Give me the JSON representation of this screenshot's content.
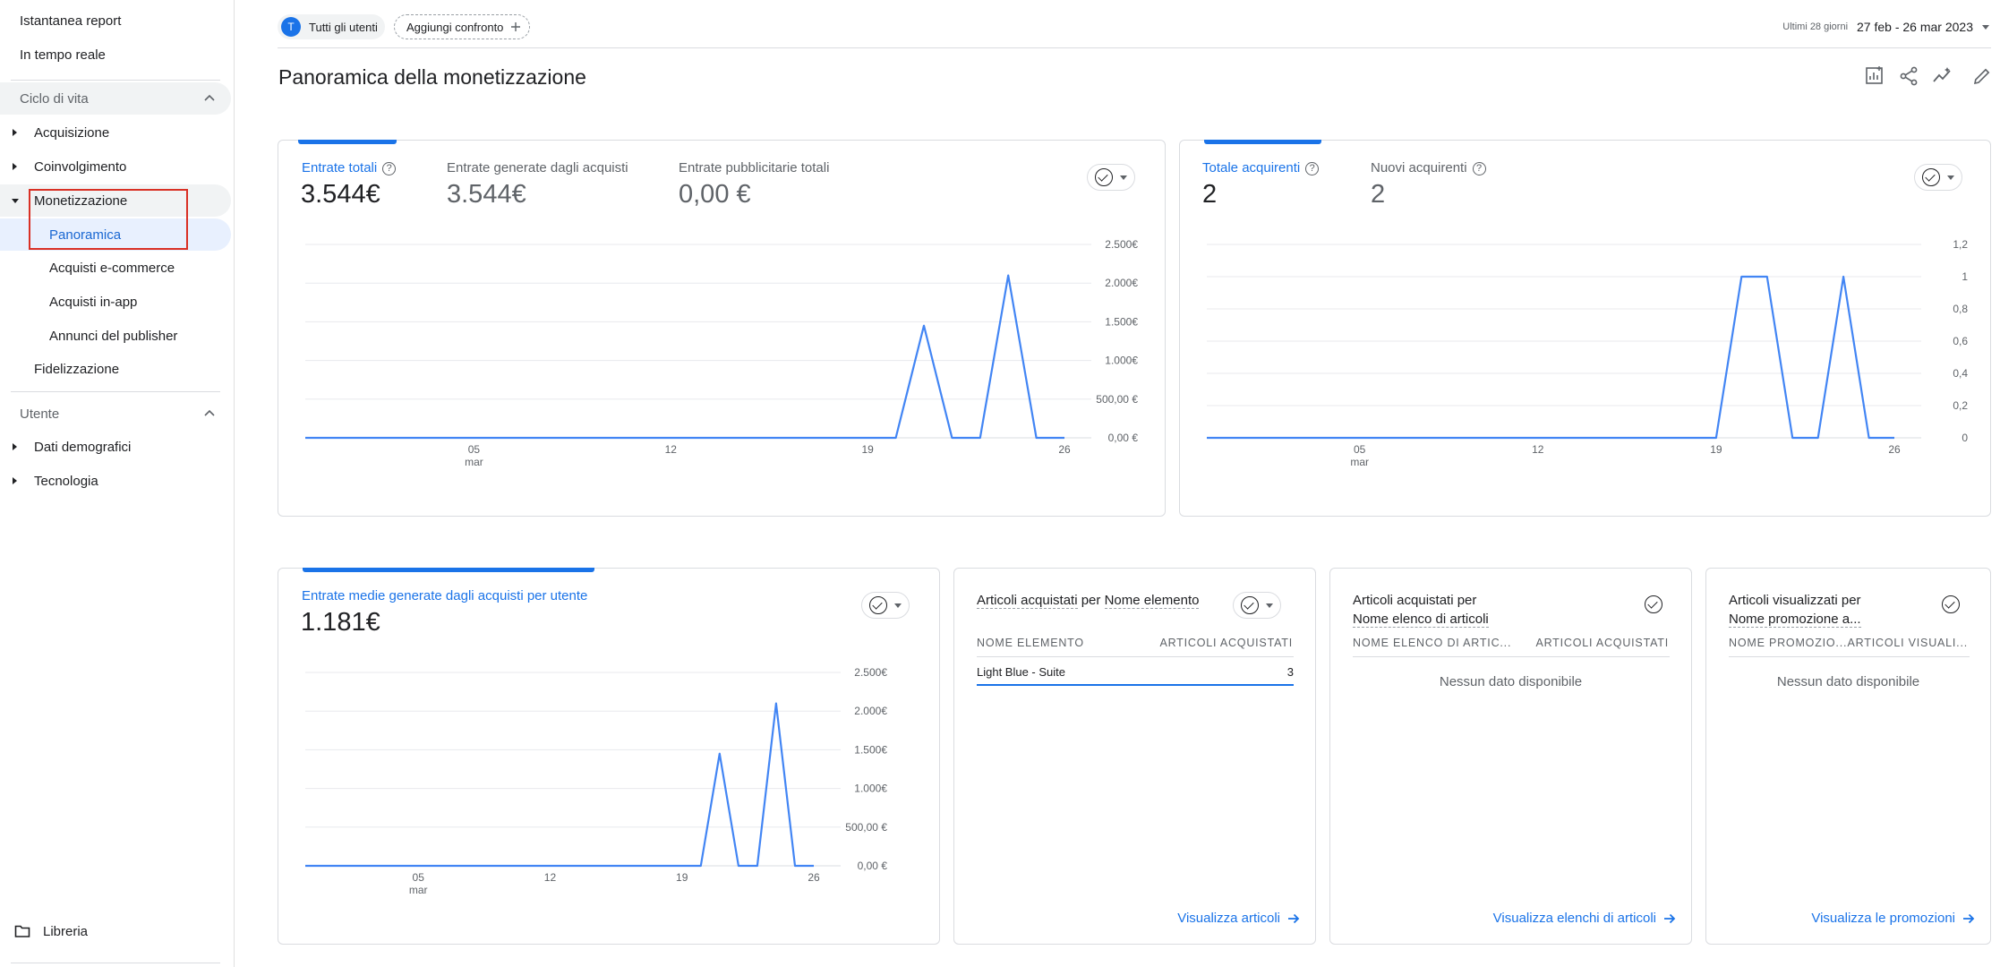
{
  "sidebar": {
    "items": [
      {
        "label": "Istantanea report"
      },
      {
        "label": "In tempo reale"
      }
    ],
    "lifecycle": {
      "label": "Ciclo di vita",
      "items": [
        {
          "label": "Acquisizione"
        },
        {
          "label": "Coinvolgimento"
        },
        {
          "label": "Monetizzazione"
        },
        {
          "label": "Panoramica"
        },
        {
          "label": "Acquisti e-commerce"
        },
        {
          "label": "Acquisti in-app"
        },
        {
          "label": "Annunci del publisher"
        },
        {
          "label": "Fidelizzazione"
        }
      ]
    },
    "user": {
      "label": "Utente",
      "items": [
        {
          "label": "Dati demografici"
        },
        {
          "label": "Tecnologia"
        }
      ]
    },
    "library": {
      "label": "Libreria"
    }
  },
  "topbar": {
    "segment_avatar": "T",
    "segment_label": "Tutti gli utenti",
    "compare_label": "Aggiungi confronto",
    "date_prefix": "Ultimi 28 giorni",
    "date_range": "27 feb - 26 mar 2023"
  },
  "page": {
    "title": "Panoramica della monetizzazione"
  },
  "card_revenue": {
    "metrics": [
      {
        "label": "Entrate totali",
        "value": "3.544€"
      },
      {
        "label": "Entrate generate dagli acquisti",
        "value": "3.544€"
      },
      {
        "label": "Entrate pubblicitarie totali",
        "value": "0,00 €"
      }
    ]
  },
  "card_buyers": {
    "metrics": [
      {
        "label": "Totale acquirenti",
        "value": "2"
      },
      {
        "label": "Nuovi acquirenti",
        "value": "2"
      }
    ]
  },
  "card_avg": {
    "metrics": [
      {
        "label": "Entrate medie generate dagli acquisti per utente",
        "value": "1.181€"
      }
    ]
  },
  "card_items": {
    "title_a": "Articoli acquistati",
    "title_b": "per",
    "title_c": "Nome elemento",
    "col1": "NOME ELEMENTO",
    "col2": "ARTICOLI ACQUISTATI",
    "row_name": "Light Blue - Suite",
    "row_value": "3",
    "link": "Visualizza articoli"
  },
  "card_lists": {
    "title_a": "Articoli acquistati per",
    "title_b": "Nome elenco di articoli",
    "col1": "NOME ELENCO DI ARTIC...",
    "col2": "ARTICOLI ACQUISTATI",
    "empty": "Nessun dato disponibile",
    "link": "Visualizza elenchi di articoli"
  },
  "card_promos": {
    "title_a": "Articoli visualizzati per",
    "title_b": "Nome promozione a...",
    "col1": "NOME PROMOZIO...",
    "col2": "ARTICOLI VISUALI...",
    "empty": "Nessun dato disponibile",
    "link": "Visualizza le promozioni"
  },
  "chart_data": [
    {
      "type": "line",
      "x": [
        "27 feb",
        "28 feb",
        "01 mar",
        "02 mar",
        "03 mar",
        "04 mar",
        "05 mar",
        "06 mar",
        "07 mar",
        "08 mar",
        "09 mar",
        "10 mar",
        "11 mar",
        "12 mar",
        "13 mar",
        "14 mar",
        "15 mar",
        "16 mar",
        "17 mar",
        "18 mar",
        "19 mar",
        "20 mar",
        "21 mar",
        "22 mar",
        "23 mar",
        "24 mar",
        "25 mar",
        "26 mar"
      ],
      "series": [
        {
          "values": [
            0,
            0,
            0,
            0,
            0,
            0,
            0,
            0,
            0,
            0,
            0,
            0,
            0,
            0,
            0,
            0,
            0,
            0,
            0,
            0,
            0,
            0,
            1450,
            0,
            0,
            2100,
            0,
            0
          ]
        }
      ],
      "yticks": [
        "2.500€",
        "2.000€",
        "1.500€",
        "1.000€",
        "500,00 €",
        "0,00 €"
      ],
      "xticks": [
        {
          "label": "05",
          "sub": "mar"
        },
        {
          "label": "12",
          "sub": ""
        },
        {
          "label": "19",
          "sub": ""
        },
        {
          "label": "26",
          "sub": ""
        }
      ],
      "ylim": [
        0,
        2500
      ]
    },
    {
      "type": "line",
      "x": [
        "27 feb",
        "28 feb",
        "01 mar",
        "02 mar",
        "03 mar",
        "04 mar",
        "05 mar",
        "06 mar",
        "07 mar",
        "08 mar",
        "09 mar",
        "10 mar",
        "11 mar",
        "12 mar",
        "13 mar",
        "14 mar",
        "15 mar",
        "16 mar",
        "17 mar",
        "18 mar",
        "19 mar",
        "20 mar",
        "21 mar",
        "22 mar",
        "23 mar",
        "24 mar",
        "25 mar",
        "26 mar"
      ],
      "series": [
        {
          "values": [
            0,
            0,
            0,
            0,
            0,
            0,
            0,
            0,
            0,
            0,
            0,
            0,
            0,
            0,
            0,
            0,
            0,
            0,
            0,
            0,
            0,
            1,
            1,
            0,
            0,
            1,
            0,
            0
          ]
        }
      ],
      "yticks": [
        "1,2",
        "1",
        "0,8",
        "0,6",
        "0,4",
        "0,2",
        "0"
      ],
      "xticks": [
        {
          "label": "05",
          "sub": "mar"
        },
        {
          "label": "12",
          "sub": ""
        },
        {
          "label": "19",
          "sub": ""
        },
        {
          "label": "26",
          "sub": ""
        }
      ],
      "ylim": [
        0,
        1.2
      ]
    },
    {
      "type": "line",
      "x": [
        "27 feb",
        "28 feb",
        "01 mar",
        "02 mar",
        "03 mar",
        "04 mar",
        "05 mar",
        "06 mar",
        "07 mar",
        "08 mar",
        "09 mar",
        "10 mar",
        "11 mar",
        "12 mar",
        "13 mar",
        "14 mar",
        "15 mar",
        "16 mar",
        "17 mar",
        "18 mar",
        "19 mar",
        "20 mar",
        "21 mar",
        "22 mar",
        "23 mar",
        "24 mar",
        "25 mar",
        "26 mar"
      ],
      "series": [
        {
          "values": [
            0,
            0,
            0,
            0,
            0,
            0,
            0,
            0,
            0,
            0,
            0,
            0,
            0,
            0,
            0,
            0,
            0,
            0,
            0,
            0,
            0,
            0,
            1450,
            0,
            0,
            2100,
            0,
            0
          ]
        }
      ],
      "yticks": [
        "2.500€",
        "2.000€",
        "1.500€",
        "1.000€",
        "500,00 €",
        "0,00 €"
      ],
      "xticks": [
        {
          "label": "05",
          "sub": "mar"
        },
        {
          "label": "12",
          "sub": ""
        },
        {
          "label": "19",
          "sub": ""
        },
        {
          "label": "26",
          "sub": ""
        }
      ],
      "ylim": [
        0,
        2500
      ]
    }
  ]
}
